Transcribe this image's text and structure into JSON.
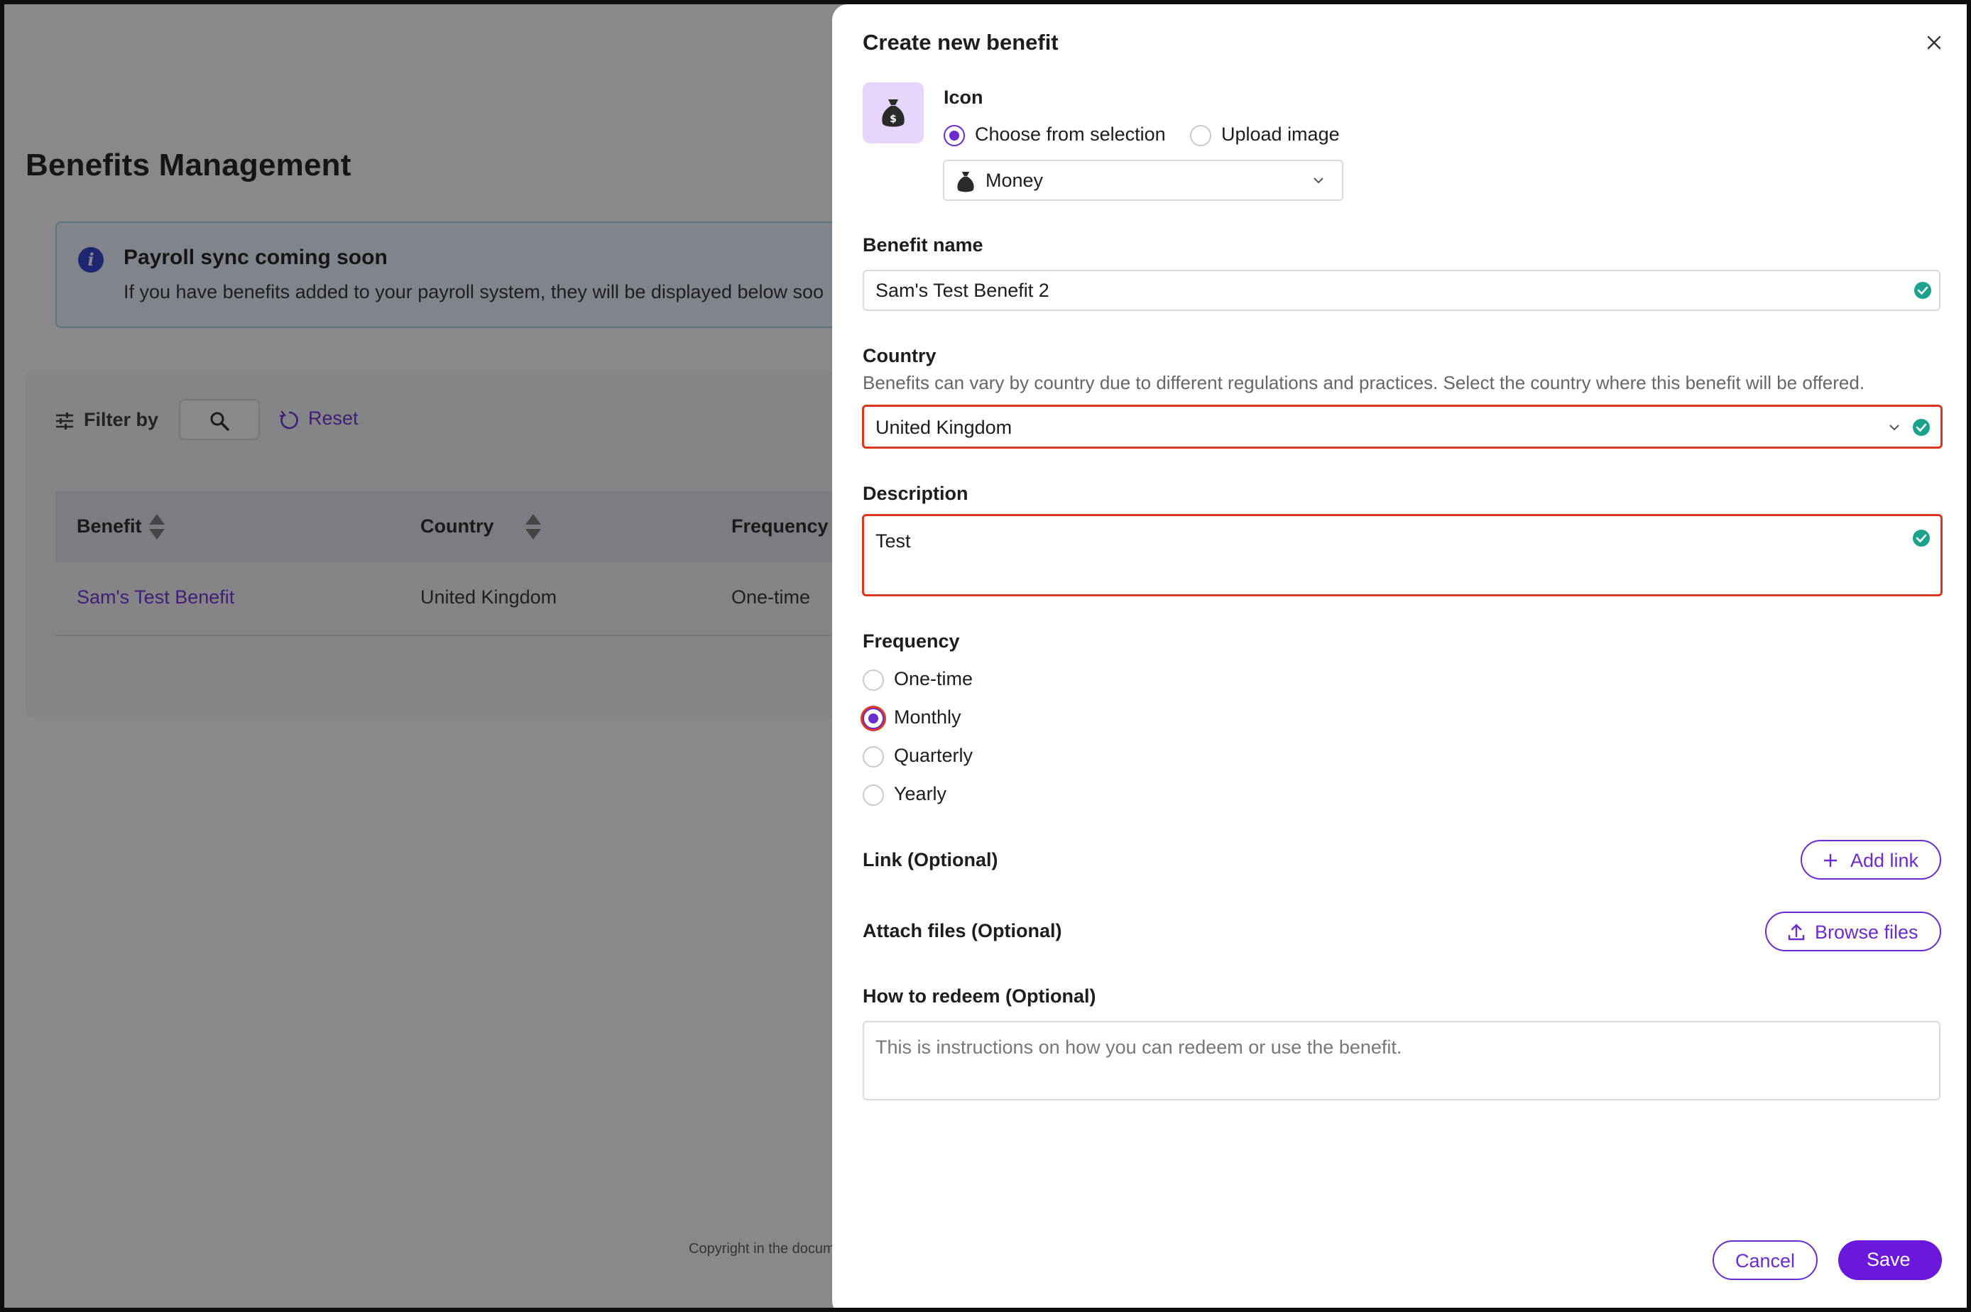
{
  "background": {
    "page_title": "Benefits Management",
    "banner": {
      "icon": "info-icon",
      "title": "Payroll sync coming soon",
      "text": "If you have benefits added to your payroll system, they will be displayed below soo"
    },
    "filters": {
      "label": "Filter by",
      "reset_label": "Reset"
    },
    "table": {
      "columns": [
        "Benefit",
        "Country",
        "Frequency"
      ],
      "rows": [
        {
          "benefit": "Sam's Test Benefit",
          "country": "United Kingdom",
          "frequency": "One-time"
        }
      ]
    },
    "copyright": "Copyright in the docum"
  },
  "drawer": {
    "title": "Create new benefit",
    "icon_section": {
      "label": "Icon",
      "options": [
        "Choose from selection",
        "Upload image"
      ],
      "selected_option": "Choose from selection",
      "selected_icon": "Money"
    },
    "benefit_name": {
      "label": "Benefit name",
      "value": "Sam's Test Benefit 2"
    },
    "country": {
      "label": "Country",
      "help": "Benefits can vary by country due to different regulations and practices. Select the country where this benefit will be offered.",
      "value": "United Kingdom"
    },
    "description": {
      "label": "Description",
      "value": "Test"
    },
    "frequency": {
      "label": "Frequency",
      "options": [
        "One-time",
        "Monthly",
        "Quarterly",
        "Yearly"
      ],
      "selected": "Monthly"
    },
    "link": {
      "label": "Link (Optional)",
      "button": "Add link"
    },
    "attach": {
      "label": "Attach files (Optional)",
      "button": "Browse files"
    },
    "redeem": {
      "label": "How to redeem (Optional)",
      "placeholder": "This is instructions on how you can redeem or use the benefit."
    },
    "footer": {
      "cancel": "Cancel",
      "save": "Save"
    }
  },
  "colors": {
    "accent": "#6a2bd1",
    "success": "#1aa38a",
    "error": "#d9381e"
  }
}
